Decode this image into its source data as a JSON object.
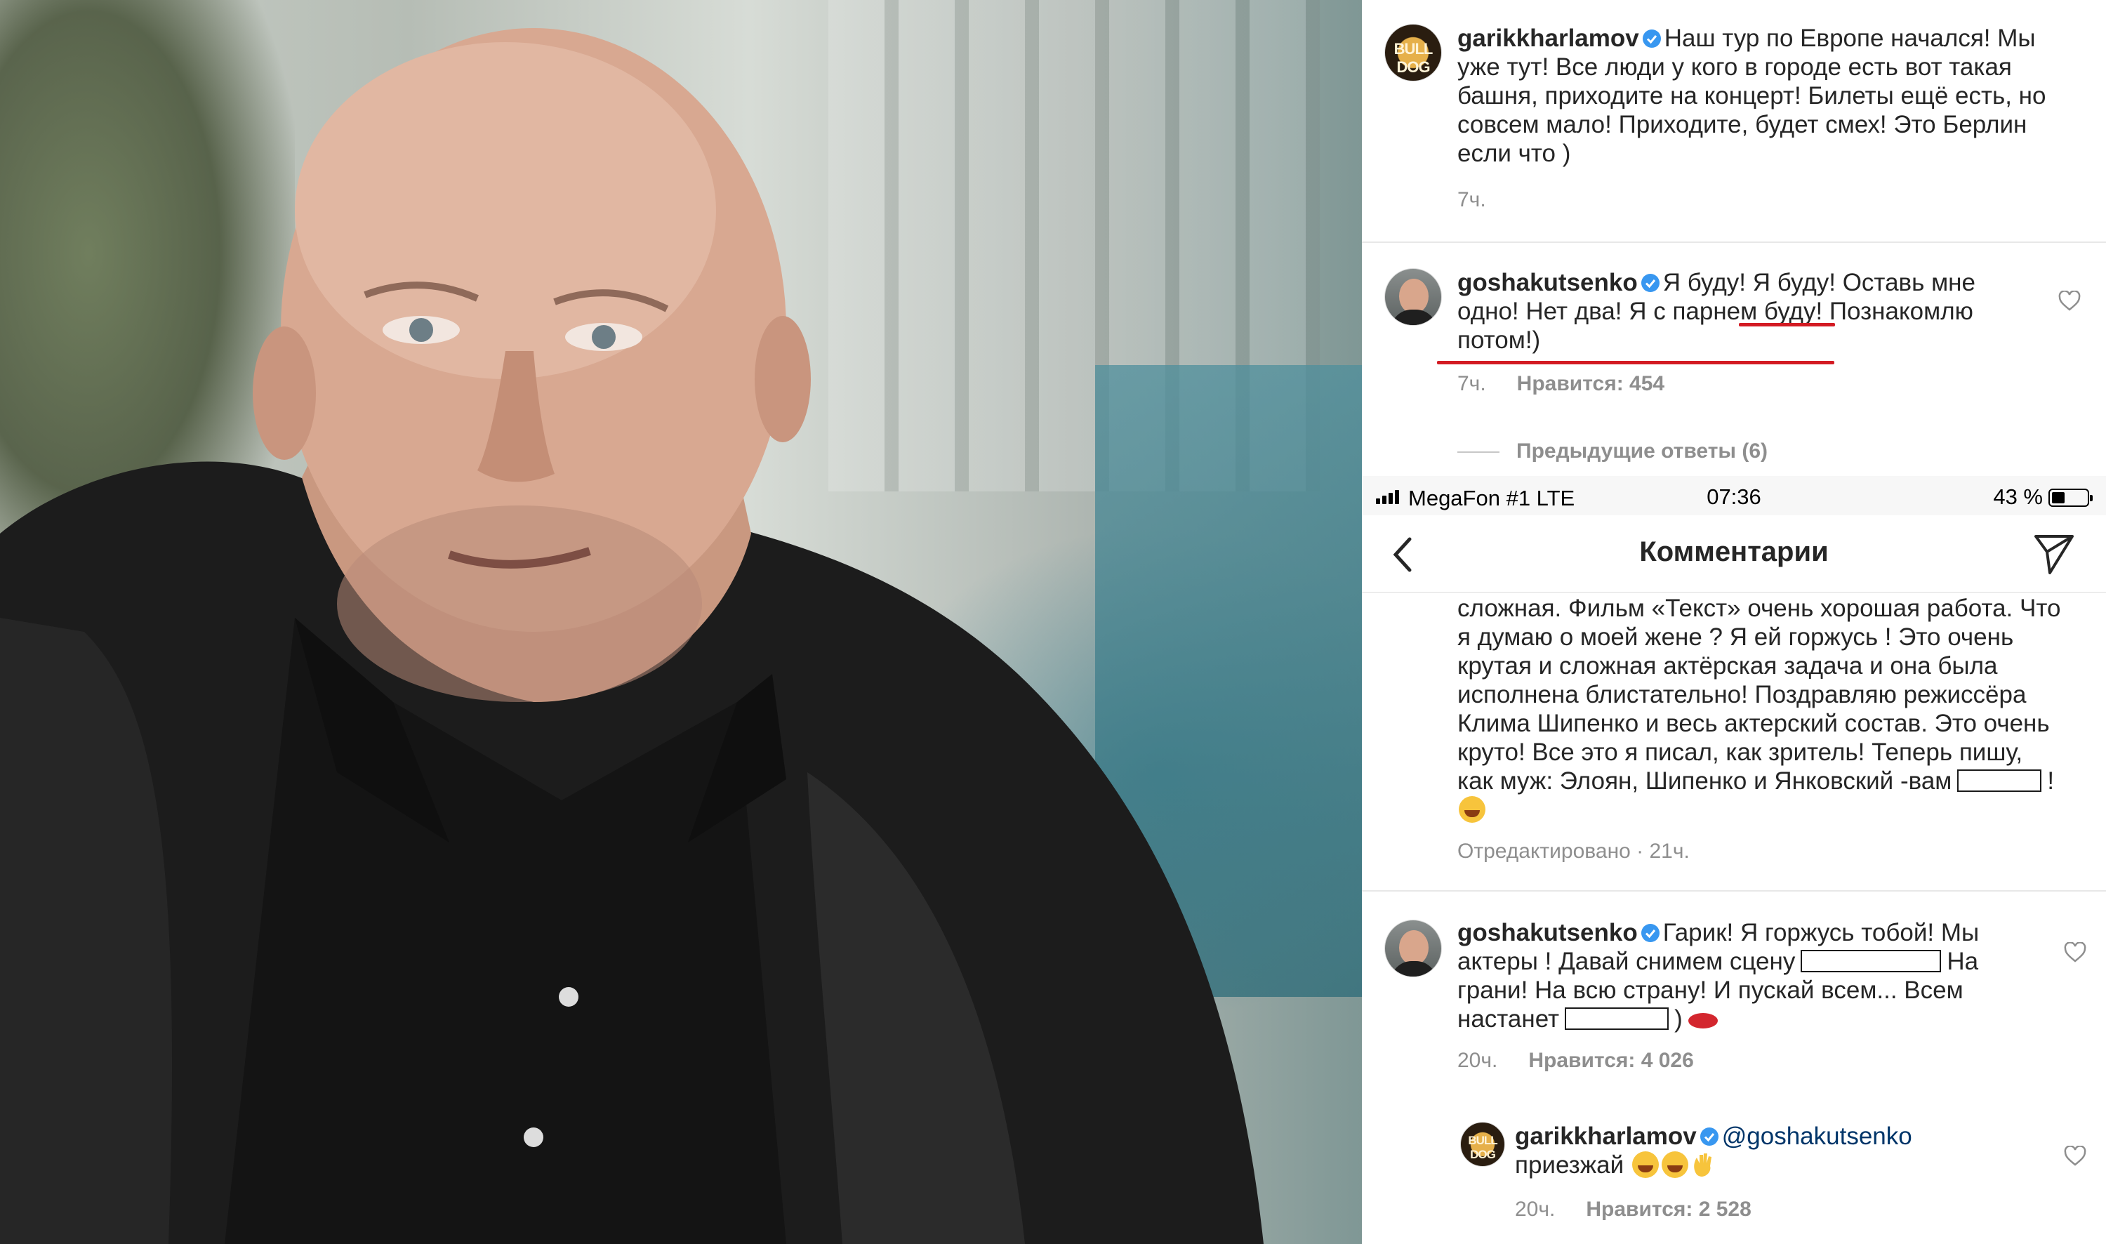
{
  "top_comment": {
    "username": "garikkharlamov",
    "text": "Наш тур по Европе начался! Мы уже тут! Все люди у кого в городе есть вот такая башня, приходите на концерт! Билеты ещё есть, но совсем мало! Приходите, будет смех! Это Берлин если что )",
    "time": "7ч."
  },
  "reply_1": {
    "username": "goshakutsenko",
    "text": "Я буду! Я буду! Оставь мне одно! Нет два! Я с парнем буду! Познакомлю потом!)",
    "time": "7ч.",
    "likes": "Нравится: 454"
  },
  "previous_replies": "Предыдущие ответы (6)",
  "status_bar": {
    "carrier": "MegaFon #1 LTE",
    "time": "07:36",
    "battery": "43 %"
  },
  "nav": {
    "title": "Комментарии"
  },
  "long_comment": {
    "text": "сложная. Фильм «Текст» очень хорошая работа. Что я думаю о моей жене ? Я ей горжусь ! Это очень крутая и сложная актёрская задача и она была исполнена блистательно! Поздравляю режиссёра Клима Шипенко и весь актерский состав. Это очень круто! Все это я писал, как зритель! Теперь пишу, как муж: Элоян, Шипенко и Янковский -вам",
    "text_end": "!",
    "meta": "Отредактировано · 21ч."
  },
  "comment_2": {
    "username": "goshakutsenko",
    "text_1": "Гарик! Я горжусь тобой! Мы актеры ! Давай снимем сцену",
    "text_2": "На грани! На всю страну! И пускай всем... Всем настанет",
    "text_3": ")",
    "time": "20ч.",
    "likes": "Нравится: 4 026"
  },
  "comment_3": {
    "username": "garikkharlamov",
    "mention": "@goshakutsenko",
    "text": "приезжай",
    "time": "20ч.",
    "likes": "Нравится: 2 528"
  },
  "avatar_labels": {
    "garik": "BULL DOG"
  },
  "colors": {
    "verified": "#3897f0",
    "underline": "#d31b23",
    "meta": "#8e8e8e"
  },
  "icons": [
    "verified-badge-icon",
    "heart-icon",
    "back-chevron-icon",
    "direct-send-icon",
    "signal-icon",
    "battery-icon",
    "laughing-emoji-icon",
    "lips-emoji-icon",
    "waving-hand-emoji-icon"
  ]
}
